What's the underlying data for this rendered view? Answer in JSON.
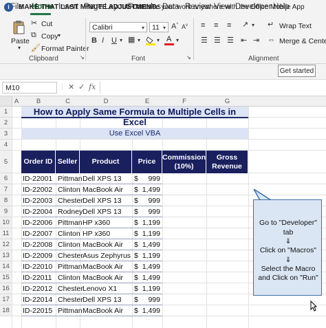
{
  "menu": [
    "File",
    "Home",
    "Insert",
    "Page Layout",
    "Formulas",
    "Data",
    "Review",
    "View",
    "Developer",
    "Help"
  ],
  "ribbon": {
    "paste": "Paste",
    "cut": "Cut",
    "copy": "Copy",
    "format_painter": "Format Painter",
    "clipboard": "Clipboard",
    "font_name": "Calibri",
    "font_size": "11",
    "font": "Font",
    "wrap_text": "Wrap Text",
    "merge_center": "Merge & Center",
    "alignment": "Alignment",
    "bold": "B",
    "italic": "I",
    "underline": "U"
  },
  "info_bar": {
    "title": "MAKE THAT LAST MINUTE ADJUSTMENT",
    "message": "Continue your work anywhere with the Office Mobile App",
    "button": "Get started"
  },
  "formula_bar": {
    "name_box": "M10",
    "cancel": "✕",
    "enter": "✓",
    "fx": "fx"
  },
  "columns": [
    "A",
    "B",
    "C",
    "D",
    "E",
    "F",
    "G"
  ],
  "rows": [
    "1",
    "2",
    "3",
    "4",
    "5",
    "6",
    "7",
    "8",
    "9",
    "10",
    "11",
    "12",
    "13",
    "14",
    "15",
    "16",
    "17",
    "18"
  ],
  "sheet": {
    "title": "How to Apply Same Formula to Multiple Cells in Excel",
    "subtitle": "Use Excel VBA",
    "headers": [
      "Order ID",
      "Seller",
      "Product",
      "Price",
      "Commission (10%)",
      "Gross Revenue"
    ],
    "currency": "$",
    "data": [
      [
        "ID-22001",
        "Pittman",
        "Dell XPS 13",
        "999"
      ],
      [
        "ID-22002",
        "Clinton",
        "MacBook Air",
        "1,499"
      ],
      [
        "ID-22003",
        "Chester",
        "Dell XPS 13",
        "999"
      ],
      [
        "ID-22004",
        "Rodney",
        "Dell XPS 13",
        "999"
      ],
      [
        "ID-22006",
        "Pittman",
        "HP  x360",
        "1,199"
      ],
      [
        "ID-22007",
        "Clinton",
        "HP  x360",
        "1,199"
      ],
      [
        "ID-22008",
        "Clinton",
        "MacBook Air",
        "1,499"
      ],
      [
        "ID-22009",
        "Chester",
        "Asus Zephyrus",
        "1,199"
      ],
      [
        "ID-22010",
        "Pittman",
        "MacBook Air",
        "1,499"
      ],
      [
        "ID-22011",
        "Clinton",
        "MacBook Air",
        "1,499"
      ],
      [
        "ID-22012",
        "Chester",
        "Lenovo  X1",
        "1,199"
      ],
      [
        "ID-22014",
        "Chester",
        "Dell XPS 13",
        "999"
      ],
      [
        "ID-22015",
        "Pittman",
        "MacBook Air",
        "1,499"
      ]
    ]
  },
  "callout": {
    "lines": [
      "Go to \"Developer\"",
      "tab",
      "⇓",
      "Click on \"Macros\"",
      "⇓",
      "Select the Macro",
      "and Click on \"Run\""
    ]
  },
  "colors": {
    "accent": "#217346",
    "header_fill": "#1a1f5e",
    "title_fill": "#dde4f3",
    "callout_fill": "#dbe6f4"
  }
}
